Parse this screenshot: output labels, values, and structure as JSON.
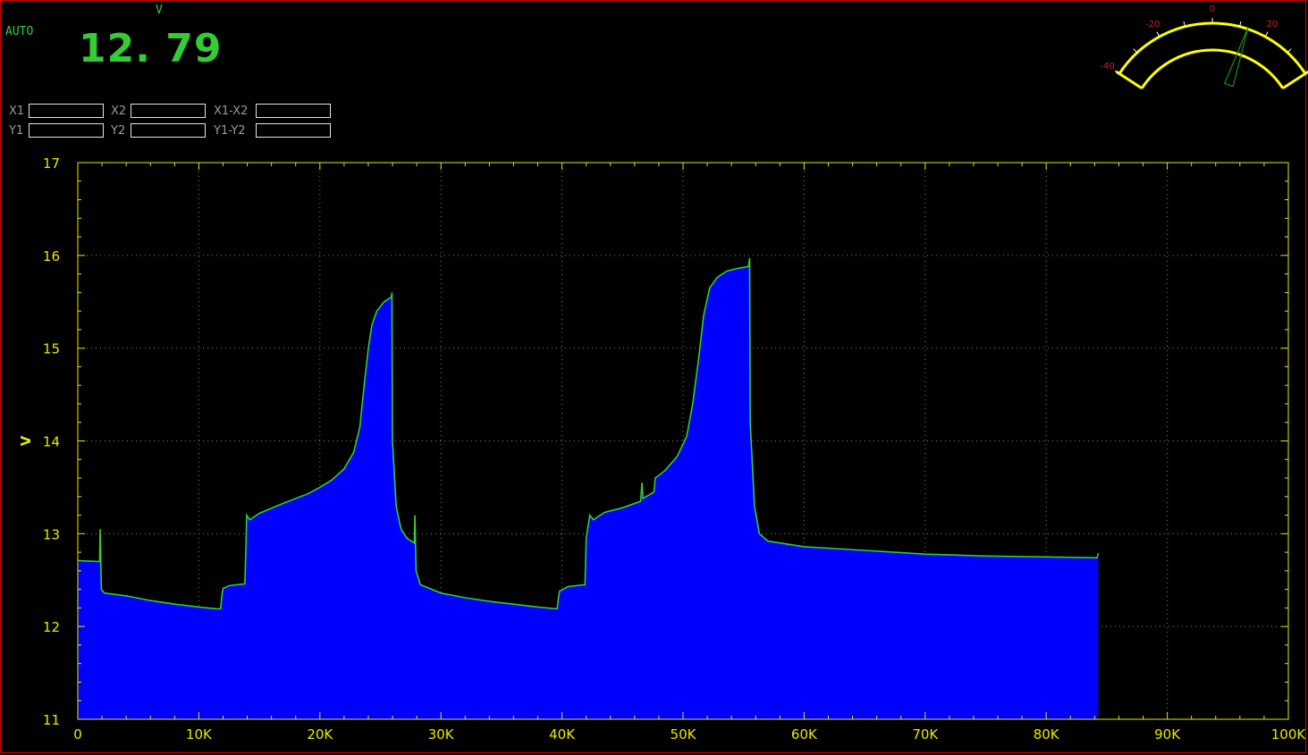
{
  "display": {
    "mode": "AUTO",
    "unit": "V",
    "reading": "12. 79"
  },
  "cursors": [
    {
      "label": "X1",
      "value": ""
    },
    {
      "label": "X2",
      "value": ""
    },
    {
      "label": "X1-X2",
      "value": ""
    },
    {
      "label": "Y1",
      "value": ""
    },
    {
      "label": "Y2",
      "value": ""
    },
    {
      "label": "Y1-Y2",
      "value": ""
    }
  ],
  "gauge": {
    "scale_labels": [
      "-40",
      "-20",
      "0",
      "20",
      "40"
    ],
    "needle_value": 13,
    "scale_min": -40,
    "scale_max": 40,
    "arc_color": "#ffff00",
    "needle_color": "#1a8f1a",
    "label_color": "#d42020"
  },
  "colors": {
    "axis": "#e8e800",
    "fill": "#0000ff",
    "trace": "#33cc33",
    "grid": "#8a8a3a",
    "frame": "#d40000"
  },
  "chart_data": {
    "type": "area",
    "title": "",
    "xlabel": "",
    "ylabel": "V",
    "xlim": [
      0,
      100000
    ],
    "ylim": [
      11,
      17
    ],
    "grid": true,
    "x_ticks": [
      0,
      10000,
      20000,
      30000,
      40000,
      50000,
      60000,
      70000,
      80000,
      90000,
      100000
    ],
    "x_tick_labels": [
      "0",
      "10K",
      "20K",
      "30K",
      "40K",
      "50K",
      "60K",
      "70K",
      "80K",
      "90K",
      "100K"
    ],
    "y_ticks": [
      11,
      12,
      13,
      14,
      15,
      16,
      17
    ],
    "y_tick_labels": [
      "11",
      "12",
      "13",
      "14",
      "15",
      "16",
      "17"
    ],
    "series": [
      {
        "points": [
          [
            0,
            12.71
          ],
          [
            1800,
            12.7
          ],
          [
            1850,
            13.05
          ],
          [
            1950,
            12.4
          ],
          [
            2200,
            12.36
          ],
          [
            4000,
            12.33
          ],
          [
            6000,
            12.28
          ],
          [
            8000,
            12.24
          ],
          [
            10000,
            12.21
          ],
          [
            11500,
            12.19
          ],
          [
            11800,
            12.19
          ],
          [
            11900,
            12.33
          ],
          [
            12000,
            12.41
          ],
          [
            12500,
            12.44
          ],
          [
            13800,
            12.46
          ],
          [
            13900,
            12.9
          ],
          [
            13950,
            13.2
          ],
          [
            14200,
            13.15
          ],
          [
            15000,
            13.22
          ],
          [
            17000,
            13.33
          ],
          [
            19000,
            13.43
          ],
          [
            20000,
            13.5
          ],
          [
            21000,
            13.58
          ],
          [
            22000,
            13.7
          ],
          [
            22800,
            13.88
          ],
          [
            23300,
            14.15
          ],
          [
            23700,
            14.65
          ],
          [
            24000,
            15.0
          ],
          [
            24300,
            15.25
          ],
          [
            24700,
            15.4
          ],
          [
            25300,
            15.5
          ],
          [
            25900,
            15.55
          ],
          [
            25950,
            15.6
          ],
          [
            26000,
            14.0
          ],
          [
            26300,
            13.3
          ],
          [
            26700,
            13.05
          ],
          [
            27200,
            12.95
          ],
          [
            27800,
            12.9
          ],
          [
            27850,
            13.2
          ],
          [
            27950,
            12.6
          ],
          [
            28300,
            12.45
          ],
          [
            30000,
            12.36
          ],
          [
            32000,
            12.31
          ],
          [
            34000,
            12.27
          ],
          [
            36000,
            12.24
          ],
          [
            38000,
            12.21
          ],
          [
            39600,
            12.19
          ],
          [
            39700,
            12.3
          ],
          [
            39800,
            12.38
          ],
          [
            40500,
            12.43
          ],
          [
            41900,
            12.45
          ],
          [
            42000,
            12.95
          ],
          [
            42300,
            13.2
          ],
          [
            42600,
            13.15
          ],
          [
            43500,
            13.23
          ],
          [
            45000,
            13.28
          ],
          [
            46500,
            13.35
          ],
          [
            46600,
            13.55
          ],
          [
            46700,
            13.38
          ],
          [
            47600,
            13.45
          ],
          [
            47700,
            13.6
          ],
          [
            48500,
            13.68
          ],
          [
            49500,
            13.83
          ],
          [
            50300,
            14.05
          ],
          [
            50800,
            14.4
          ],
          [
            51300,
            14.9
          ],
          [
            51700,
            15.35
          ],
          [
            52200,
            15.65
          ],
          [
            52800,
            15.76
          ],
          [
            53600,
            15.83
          ],
          [
            54500,
            15.86
          ],
          [
            55400,
            15.88
          ],
          [
            55500,
            15.97
          ],
          [
            55550,
            14.2
          ],
          [
            55900,
            13.3
          ],
          [
            56300,
            13.0
          ],
          [
            57000,
            12.92
          ],
          [
            60000,
            12.86
          ],
          [
            65000,
            12.82
          ],
          [
            70000,
            12.78
          ],
          [
            75000,
            12.76
          ],
          [
            80000,
            12.75
          ],
          [
            84200,
            12.74
          ],
          [
            84300,
            12.79
          ]
        ]
      }
    ]
  }
}
